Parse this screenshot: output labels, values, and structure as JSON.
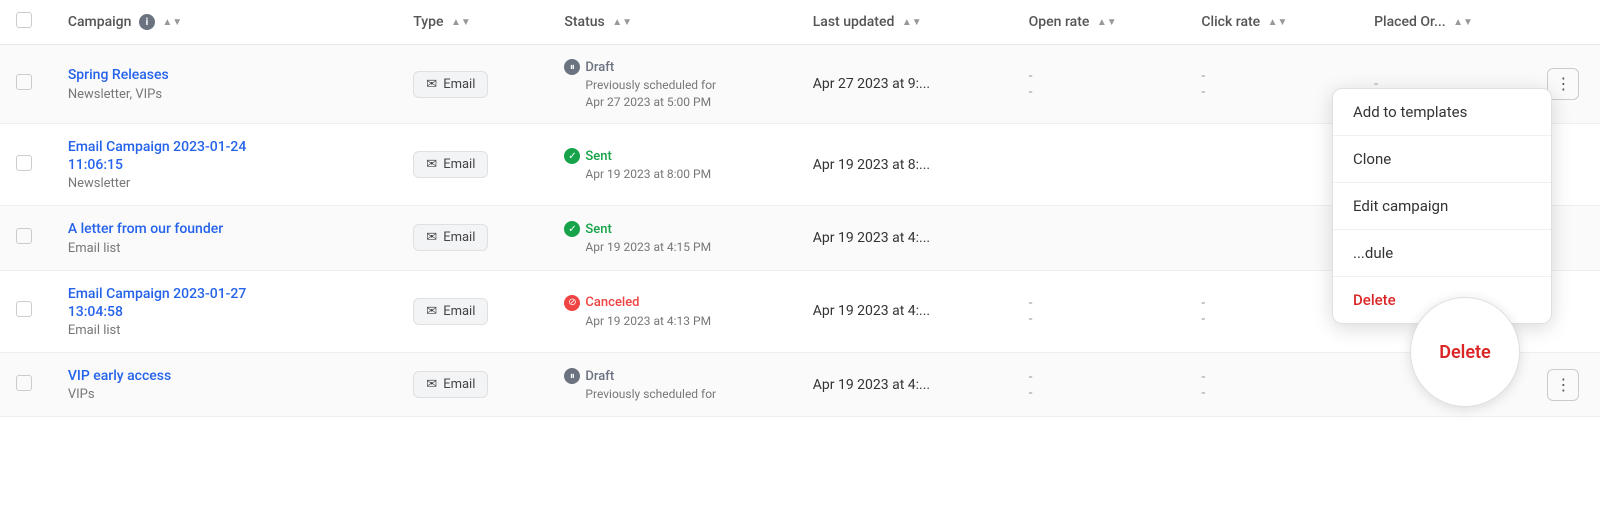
{
  "header": {
    "columns": [
      {
        "key": "campaign",
        "label": "Campaign",
        "sortable": true,
        "hasInfo": true
      },
      {
        "key": "type",
        "label": "Type",
        "sortable": true
      },
      {
        "key": "status",
        "label": "Status",
        "sortable": true
      },
      {
        "key": "last_updated",
        "label": "Last updated",
        "sortable": true
      },
      {
        "key": "open_rate",
        "label": "Open rate",
        "sortable": true
      },
      {
        "key": "click_rate",
        "label": "Click rate",
        "sortable": true
      },
      {
        "key": "placed_orders",
        "label": "Placed Or...",
        "sortable": true
      }
    ]
  },
  "rows": [
    {
      "id": 1,
      "name": "Spring Releases",
      "sub": "Newsletter, VIPs",
      "type": "Email",
      "status_type": "draft",
      "status_label": "Draft",
      "status_detail_line1": "Previously scheduled for",
      "status_detail_line2": "Apr 27 2023 at 5:00 PM",
      "last_updated": "Apr 27 2023 at 9:...",
      "open_rate": "-",
      "open_rate2": "-",
      "click_rate": "-",
      "click_rate2": "-",
      "placed_orders": "-",
      "placed_orders2": "-",
      "show_actions": true
    },
    {
      "id": 2,
      "name": "Email Campaign 2023-01-24",
      "name_line2": "11:06:15",
      "sub": "Newsletter",
      "type": "Email",
      "status_type": "sent",
      "status_label": "Sent",
      "status_detail_line1": "Apr 19 2023 at 8:00 PM",
      "status_detail_line2": "",
      "last_updated": "Apr 19 2023 at 8:...",
      "open_rate": "",
      "click_rate": "",
      "placed_orders": "",
      "show_actions": false
    },
    {
      "id": 3,
      "name": "A letter from our founder",
      "sub": "Email list",
      "type": "Email",
      "status_type": "sent",
      "status_label": "Sent",
      "status_detail_line1": "Apr 19 2023 at 4:15 PM",
      "status_detail_line2": "",
      "last_updated": "Apr 19 2023 at 4:...",
      "open_rate": "",
      "click_rate": "",
      "placed_orders": "",
      "show_actions": false
    },
    {
      "id": 4,
      "name": "Email Campaign 2023-01-27",
      "name_line2": "13:04:58",
      "sub": "Email list",
      "type": "Email",
      "status_type": "cancelled",
      "status_label": "Canceled",
      "status_detail_line1": "Apr 19 2023 at 4:13 PM",
      "status_detail_line2": "",
      "last_updated": "Apr 19 2023 at 4:...",
      "open_rate": "-",
      "open_rate2": "-",
      "click_rate": "-",
      "click_rate2": "-",
      "placed_orders": "",
      "show_actions": false
    },
    {
      "id": 5,
      "name": "VIP early access",
      "sub": "VIPs",
      "type": "Email",
      "status_type": "draft",
      "status_label": "Draft",
      "status_detail_line1": "Previously scheduled for",
      "status_detail_line2": "",
      "last_updated": "Apr 19 2023 at 4:...",
      "open_rate": "-",
      "click_rate": "-",
      "placed_orders": "",
      "show_actions": true
    }
  ],
  "context_menu": {
    "items": [
      {
        "key": "add_to_templates",
        "label": "Add to templates"
      },
      {
        "key": "clone",
        "label": "Clone"
      },
      {
        "key": "edit_campaign",
        "label": "Edit campaign"
      },
      {
        "key": "reschedule",
        "label": "...dule"
      },
      {
        "key": "delete",
        "label": "Delete"
      }
    ]
  },
  "icons": {
    "mail": "✉",
    "pause": "⏸",
    "check": "✓",
    "cancel": "⊘",
    "info": "i",
    "three_dot": "⋮",
    "sort_up": "▲",
    "sort_down": "▼"
  }
}
